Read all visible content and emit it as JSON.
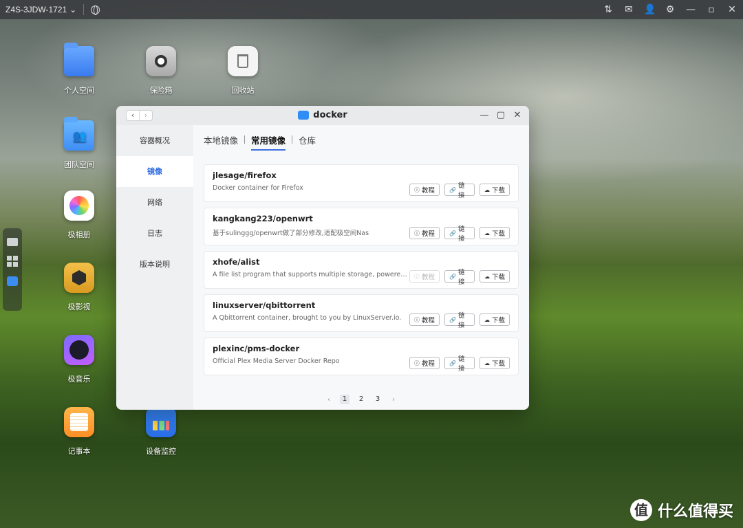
{
  "topbar": {
    "device_name": "Z4S-3JDW-1721",
    "caret": "⌄",
    "icons": [
      "transfer-icon",
      "mail-icon",
      "user-icon",
      "gear-icon",
      "minimize-icon",
      "maximize-icon",
      "close-icon"
    ]
  },
  "desktop": {
    "icons": [
      {
        "label": "个人空间",
        "icon": "folder-icon"
      },
      {
        "label": "保险箱",
        "icon": "safe-icon"
      },
      {
        "label": "回收站",
        "icon": "trash-icon"
      },
      {
        "label": "团队空间",
        "icon": "team-folder-icon"
      },
      {
        "label": "极相册",
        "icon": "photo-icon"
      },
      {
        "label": "极影视",
        "icon": "video-icon"
      },
      {
        "label": "极音乐",
        "icon": "music-icon"
      },
      {
        "label": "记事本",
        "icon": "notes-icon"
      },
      {
        "label": "设备监控",
        "icon": "monitor-icon"
      }
    ]
  },
  "window": {
    "title": "docker",
    "nav": {
      "back": "‹",
      "forward": "›"
    },
    "controls": {
      "minimize": "—",
      "maximize": "▢",
      "close": "✕"
    },
    "sidebar": {
      "items": [
        "容器概况",
        "镜像",
        "网络",
        "日志",
        "版本说明"
      ],
      "active_index": 1
    },
    "tabs": [
      "本地镜像",
      "常用镜像",
      "仓库"
    ],
    "active_tab": 1,
    "buttons": {
      "tutorial": "教程",
      "link": "链接",
      "download": "下载"
    },
    "images": [
      {
        "name": "jlesage/firefox",
        "desc": "Docker container for Firefox",
        "tutorial_enabled": true
      },
      {
        "name": "kangkang223/openwrt",
        "desc": "基于sulinggg/openwrt做了部分修改,适配极空间Nas",
        "tutorial_enabled": true
      },
      {
        "name": "xhofe/alist",
        "desc": "A file list program that supports multiple storage, powered by G...",
        "tutorial_enabled": false
      },
      {
        "name": "linuxserver/qbittorrent",
        "desc": "A Qbittorrent container, brought to you by LinuxServer.io.",
        "tutorial_enabled": true
      },
      {
        "name": "plexinc/pms-docker",
        "desc": "Official Plex Media Server Docker Repo",
        "tutorial_enabled": true
      }
    ],
    "pagination": {
      "prev": "‹",
      "pages": [
        "1",
        "2",
        "3"
      ],
      "current": "1",
      "next": "›"
    }
  },
  "watermark": {
    "logo": "值",
    "text": "什么值得买"
  },
  "colors": {
    "accent": "#2f6de0",
    "docker_blue": "#2f8df5"
  }
}
